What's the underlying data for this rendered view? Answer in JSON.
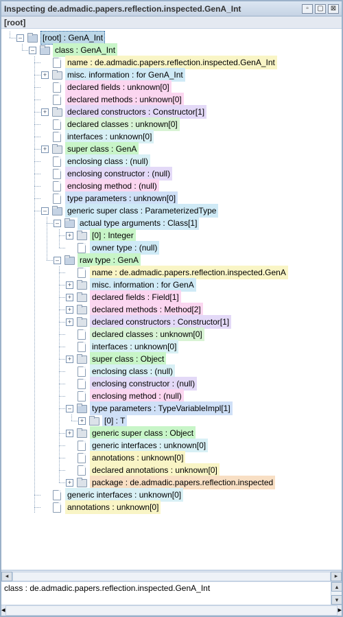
{
  "window": {
    "title": "Inspecting de.admadic.papers.reflection.inspected.GenA_Int",
    "root_label": "[root]"
  },
  "status": "class : de.admadic.papers.reflection.inspected.GenA_Int",
  "tree": [
    {
      "i": [
        "l"
      ],
      "h": "exp",
      "ic": "folder open",
      "c": "c-selected",
      "t": "[root] : GenA_Int"
    },
    {
      "i": [
        "b",
        "l"
      ],
      "h": "exp",
      "ic": "folder open",
      "c": "c-green",
      "t": "class : GenA_Int"
    },
    {
      "i": [
        "b",
        "b",
        "t"
      ],
      "h": "none",
      "ic": "leaf",
      "c": "c-lyellow",
      "t": "name : de.admadic.papers.reflection.inspected.GenA_Int"
    },
    {
      "i": [
        "b",
        "b",
        "t"
      ],
      "h": "col",
      "ic": "folder",
      "c": "c-lblue",
      "t": "misc. information : for GenA_Int"
    },
    {
      "i": [
        "b",
        "b",
        "t"
      ],
      "h": "none",
      "ic": "leaf",
      "c": "c-pink",
      "t": "declared fields : unknown[0]"
    },
    {
      "i": [
        "b",
        "b",
        "t"
      ],
      "h": "none",
      "ic": "leaf",
      "c": "c-pink",
      "t": "declared methods : unknown[0]"
    },
    {
      "i": [
        "b",
        "b",
        "t"
      ],
      "h": "col",
      "ic": "folder",
      "c": "c-purple",
      "t": "declared constructors : Constructor[1]"
    },
    {
      "i": [
        "b",
        "b",
        "t"
      ],
      "h": "none",
      "ic": "leaf",
      "c": "c-lgreen2",
      "t": "declared classes : unknown[0]"
    },
    {
      "i": [
        "b",
        "b",
        "t"
      ],
      "h": "none",
      "ic": "leaf",
      "c": "c-lblue3",
      "t": "interfaces : unknown[0]"
    },
    {
      "i": [
        "b",
        "b",
        "t"
      ],
      "h": "col",
      "ic": "folder",
      "c": "c-green",
      "t": "super class : GenA"
    },
    {
      "i": [
        "b",
        "b",
        "t"
      ],
      "h": "none",
      "ic": "leaf",
      "c": "c-lblue3",
      "t": "enclosing class : (null)"
    },
    {
      "i": [
        "b",
        "b",
        "t"
      ],
      "h": "none",
      "ic": "leaf",
      "c": "c-purple",
      "t": "enclosing constructor : (null)"
    },
    {
      "i": [
        "b",
        "b",
        "t"
      ],
      "h": "none",
      "ic": "leaf",
      "c": "c-pink",
      "t": "enclosing method : (null)"
    },
    {
      "i": [
        "b",
        "b",
        "t"
      ],
      "h": "none",
      "ic": "leaf",
      "c": "c-blue2",
      "t": "type parameters : unknown[0]"
    },
    {
      "i": [
        "b",
        "b",
        "t"
      ],
      "h": "exp",
      "ic": "folder open",
      "c": "c-lblue",
      "t": "generic super class : ParameterizedType"
    },
    {
      "i": [
        "b",
        "b",
        "v",
        "t"
      ],
      "h": "exp",
      "ic": "folder open",
      "c": "c-lblue",
      "t": "actual type arguments : Class[1]"
    },
    {
      "i": [
        "b",
        "b",
        "v",
        "v",
        "t"
      ],
      "h": "col",
      "ic": "folder",
      "c": "c-green",
      "t": "[0] : Integer"
    },
    {
      "i": [
        "b",
        "b",
        "v",
        "v",
        "l"
      ],
      "h": "none",
      "ic": "leaf",
      "c": "c-lblue",
      "t": "owner type : (null)"
    },
    {
      "i": [
        "b",
        "b",
        "v",
        "l"
      ],
      "h": "exp",
      "ic": "folder open",
      "c": "c-green",
      "t": "raw type : GenA"
    },
    {
      "i": [
        "b",
        "b",
        "v",
        "b",
        "t"
      ],
      "h": "none",
      "ic": "leaf",
      "c": "c-lyellow",
      "t": "name : de.admadic.papers.reflection.inspected.GenA"
    },
    {
      "i": [
        "b",
        "b",
        "v",
        "b",
        "t"
      ],
      "h": "col",
      "ic": "folder",
      "c": "c-lblue",
      "t": "misc. information : for GenA"
    },
    {
      "i": [
        "b",
        "b",
        "v",
        "b",
        "t"
      ],
      "h": "col",
      "ic": "folder",
      "c": "c-pink",
      "t": "declared fields : Field[1]"
    },
    {
      "i": [
        "b",
        "b",
        "v",
        "b",
        "t"
      ],
      "h": "col",
      "ic": "folder",
      "c": "c-pink",
      "t": "declared methods : Method[2]"
    },
    {
      "i": [
        "b",
        "b",
        "v",
        "b",
        "t"
      ],
      "h": "col",
      "ic": "folder",
      "c": "c-purple",
      "t": "declared constructors : Constructor[1]"
    },
    {
      "i": [
        "b",
        "b",
        "v",
        "b",
        "t"
      ],
      "h": "none",
      "ic": "leaf",
      "c": "c-lgreen2",
      "t": "declared classes : unknown[0]"
    },
    {
      "i": [
        "b",
        "b",
        "v",
        "b",
        "t"
      ],
      "h": "none",
      "ic": "leaf",
      "c": "c-lblue3",
      "t": "interfaces : unknown[0]"
    },
    {
      "i": [
        "b",
        "b",
        "v",
        "b",
        "t"
      ],
      "h": "col",
      "ic": "folder",
      "c": "c-green",
      "t": "super class : Object"
    },
    {
      "i": [
        "b",
        "b",
        "v",
        "b",
        "t"
      ],
      "h": "none",
      "ic": "leaf",
      "c": "c-lblue3",
      "t": "enclosing class : (null)"
    },
    {
      "i": [
        "b",
        "b",
        "v",
        "b",
        "t"
      ],
      "h": "none",
      "ic": "leaf",
      "c": "c-purple",
      "t": "enclosing constructor : (null)"
    },
    {
      "i": [
        "b",
        "b",
        "v",
        "b",
        "t"
      ],
      "h": "none",
      "ic": "leaf",
      "c": "c-pink",
      "t": "enclosing method : (null)"
    },
    {
      "i": [
        "b",
        "b",
        "v",
        "b",
        "t"
      ],
      "h": "exp",
      "ic": "folder open",
      "c": "c-blue2",
      "t": "type parameters : TypeVariableImpl[1]"
    },
    {
      "i": [
        "b",
        "b",
        "v",
        "b",
        "v",
        "l"
      ],
      "h": "col",
      "ic": "folder",
      "c": "c-blue2",
      "t": "[0] : T"
    },
    {
      "i": [
        "b",
        "b",
        "v",
        "b",
        "t"
      ],
      "h": "col",
      "ic": "folder",
      "c": "c-green",
      "t": "generic super class : Object"
    },
    {
      "i": [
        "b",
        "b",
        "v",
        "b",
        "t"
      ],
      "h": "none",
      "ic": "leaf",
      "c": "c-lblue3",
      "t": "generic interfaces : unknown[0]"
    },
    {
      "i": [
        "b",
        "b",
        "v",
        "b",
        "t"
      ],
      "h": "none",
      "ic": "leaf",
      "c": "c-lyellow",
      "t": "annotations : unknown[0]"
    },
    {
      "i": [
        "b",
        "b",
        "v",
        "b",
        "t"
      ],
      "h": "none",
      "ic": "leaf",
      "c": "c-lyellow",
      "t": "declared annotations : unknown[0]"
    },
    {
      "i": [
        "b",
        "b",
        "v",
        "b",
        "l"
      ],
      "h": "col",
      "ic": "folder",
      "c": "c-orange",
      "t": "package : de.admadic.papers.reflection.inspected"
    },
    {
      "i": [
        "b",
        "b",
        "t"
      ],
      "h": "none",
      "ic": "leaf",
      "c": "c-lblue3",
      "t": "generic interfaces : unknown[0]"
    },
    {
      "i": [
        "b",
        "b",
        "t"
      ],
      "h": "none",
      "ic": "leaf",
      "c": "c-lyellow",
      "t": "annotations : unknown[0]"
    }
  ]
}
